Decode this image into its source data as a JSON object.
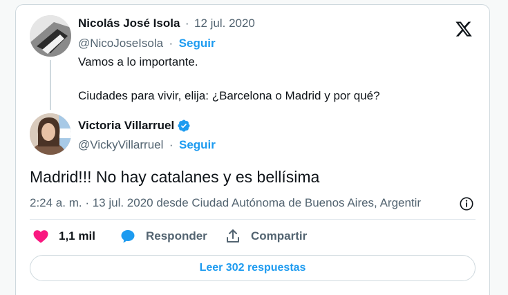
{
  "parent_tweet": {
    "display_name": "Nicolás José Isola",
    "separator": "·",
    "date": "12 jul. 2020",
    "handle": "@NicoJoseIsola",
    "follow_label": "Seguir",
    "text_line1": "Vamos a lo importante.",
    "text_line2": "Ciudades para vivir, elija: ¿Barcelona o Madrid y por qué?"
  },
  "reply_tweet": {
    "display_name": "Victoria Villarruel",
    "verified": true,
    "handle": "@VickyVillarruel",
    "separator": "·",
    "follow_label": "Seguir",
    "text": "Madrid!!! No hay catalanes y es bellísima",
    "meta": "2:24 a. m. · 13 jul. 2020 desde Ciudad Autónoma de Buenos Aires, Argentir"
  },
  "actions": {
    "likes_count": "1,1 mil",
    "reply_label": "Responder",
    "share_label": "Compartir"
  },
  "read_replies_label": "Leer 302 respuestas",
  "colors": {
    "accent": "#1d9bf0",
    "like": "#f91880",
    "muted": "#536471"
  },
  "icons": [
    "x-logo-icon",
    "verified-badge-icon",
    "info-icon",
    "heart-icon",
    "reply-bubble-icon",
    "share-icon"
  ]
}
